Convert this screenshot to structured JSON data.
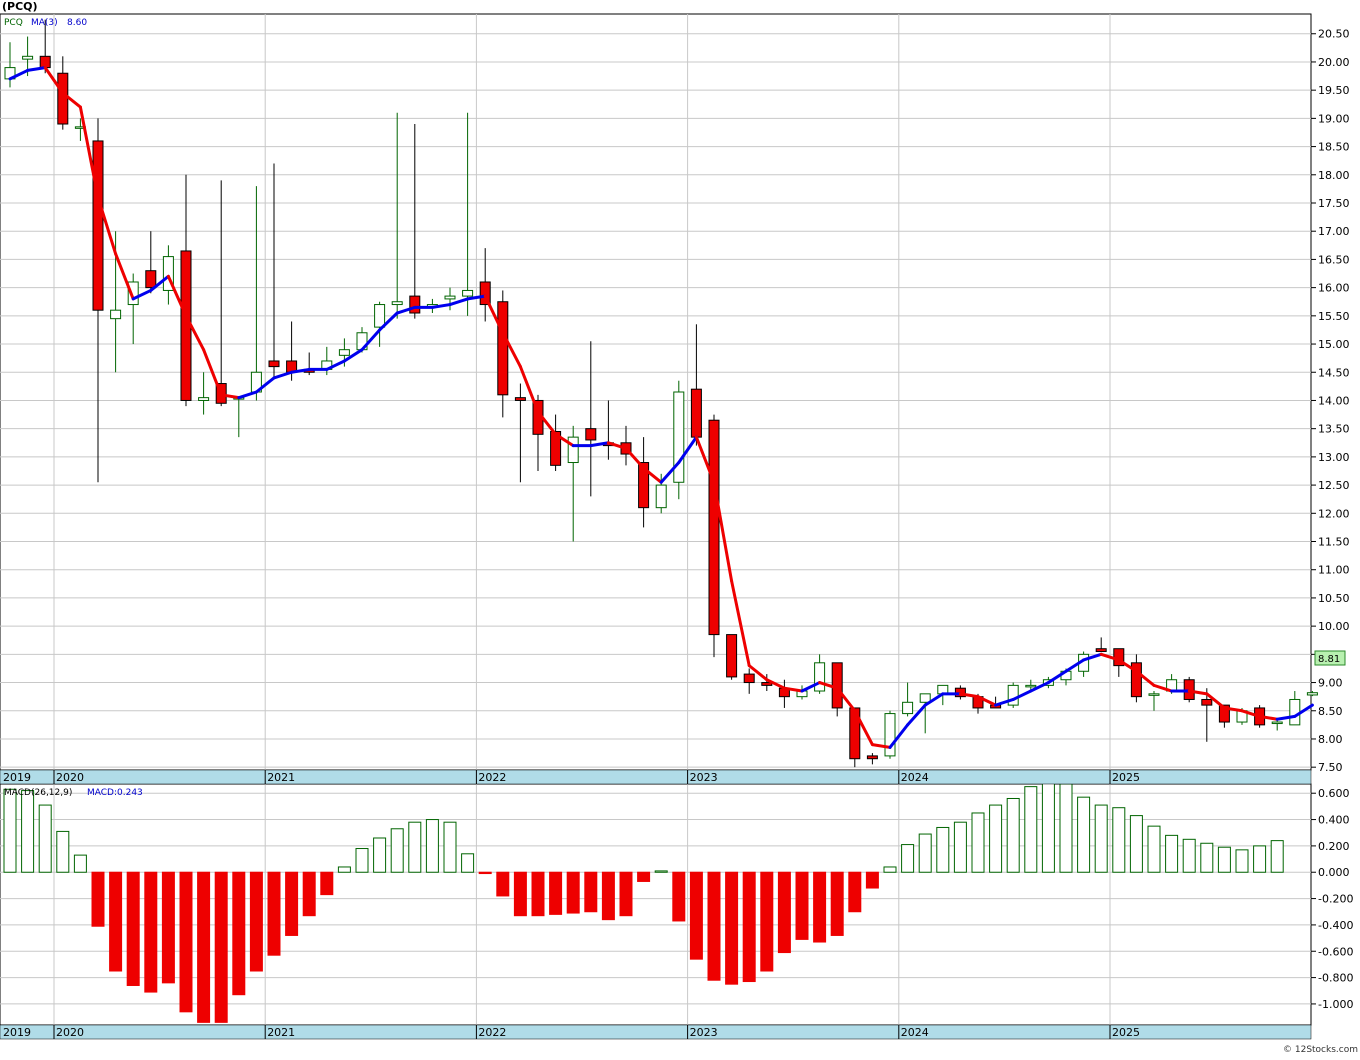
{
  "header": {
    "symbol_title": "(PCQ)",
    "legend_symbol": "PCQ",
    "ma_label": "MA(3)",
    "ma_value": "8.60",
    "last_price_badge": "8.81",
    "macd_label": "MACD(26,12,9)",
    "macd_value": "MACD:0.243",
    "watermark": "© 12Stocks.com"
  },
  "colors": {
    "up_candle_stroke": "#006400",
    "down_candle_fill": "#ee0000",
    "ma_up": "#0000ee",
    "ma_down": "#ee0000",
    "grid": "#c8c8c8",
    "date_band": "#b0dce8",
    "macd_pos_stroke": "#006400",
    "macd_neg_fill": "#ee0000",
    "badge_fill": "#b8f0b0"
  },
  "chart_data": [
    {
      "type": "candlestick",
      "title": "(PCQ)",
      "interval": "monthly",
      "ylim": [
        7.45,
        20.85
      ],
      "y_ticks": [
        "20.50",
        "20.00",
        "19.50",
        "19.00",
        "18.50",
        "18.00",
        "17.50",
        "17.00",
        "16.50",
        "16.00",
        "15.50",
        "15.00",
        "14.50",
        "14.00",
        "13.50",
        "13.00",
        "12.50",
        "12.00",
        "11.50",
        "11.00",
        "10.50",
        "10.00",
        "9.50",
        "9.00",
        "8.50",
        "8.00",
        "7.50"
      ],
      "x_labels": [
        "2019",
        "2020",
        "2021",
        "2022",
        "2023",
        "2024",
        "2025"
      ],
      "grid": true,
      "ohlc": [
        {
          "o": 19.7,
          "h": 20.35,
          "l": 19.55,
          "c": 19.9
        },
        {
          "o": 20.05,
          "h": 20.45,
          "l": 19.75,
          "c": 20.1
        },
        {
          "o": 20.1,
          "h": 20.75,
          "l": 19.8,
          "c": 19.9
        },
        {
          "o": 19.8,
          "h": 20.1,
          "l": 18.8,
          "c": 18.9
        },
        {
          "o": 18.85,
          "h": 19.0,
          "l": 18.6,
          "c": 18.85
        },
        {
          "o": 18.6,
          "h": 19.0,
          "l": 12.55,
          "c": 15.6
        },
        {
          "o": 15.45,
          "h": 17.0,
          "l": 14.5,
          "c": 15.6
        },
        {
          "o": 15.7,
          "h": 16.25,
          "l": 15.0,
          "c": 16.1
        },
        {
          "o": 16.3,
          "h": 17.0,
          "l": 15.9,
          "c": 16.0
        },
        {
          "o": 15.95,
          "h": 16.75,
          "l": 15.7,
          "c": 16.55
        },
        {
          "o": 16.65,
          "h": 18.0,
          "l": 13.9,
          "c": 14.0
        },
        {
          "o": 14.0,
          "h": 14.5,
          "l": 13.75,
          "c": 14.05
        },
        {
          "o": 14.3,
          "h": 17.9,
          "l": 13.9,
          "c": 13.95
        },
        {
          "o": 14.05,
          "h": 14.05,
          "l": 13.35,
          "c": 14.05
        },
        {
          "o": 14.15,
          "h": 17.8,
          "l": 14.0,
          "c": 14.5
        },
        {
          "o": 14.7,
          "h": 18.2,
          "l": 14.4,
          "c": 14.6
        },
        {
          "o": 14.7,
          "h": 15.4,
          "l": 14.35,
          "c": 14.5
        },
        {
          "o": 14.55,
          "h": 14.85,
          "l": 14.45,
          "c": 14.5
        },
        {
          "o": 14.55,
          "h": 14.95,
          "l": 14.45,
          "c": 14.7
        },
        {
          "o": 14.8,
          "h": 15.1,
          "l": 14.6,
          "c": 14.9
        },
        {
          "o": 14.9,
          "h": 15.3,
          "l": 14.85,
          "c": 15.2
        },
        {
          "o": 15.3,
          "h": 15.75,
          "l": 14.95,
          "c": 15.7
        },
        {
          "o": 15.7,
          "h": 19.1,
          "l": 15.45,
          "c": 15.75
        },
        {
          "o": 15.85,
          "h": 18.9,
          "l": 15.45,
          "c": 15.55
        },
        {
          "o": 15.65,
          "h": 15.8,
          "l": 15.55,
          "c": 15.7
        },
        {
          "o": 15.8,
          "h": 16.0,
          "l": 15.6,
          "c": 15.85
        },
        {
          "o": 15.85,
          "h": 19.1,
          "l": 15.5,
          "c": 15.95
        },
        {
          "o": 16.1,
          "h": 16.7,
          "l": 15.4,
          "c": 15.7
        },
        {
          "o": 15.75,
          "h": 15.95,
          "l": 13.7,
          "c": 14.1
        },
        {
          "o": 14.05,
          "h": 14.3,
          "l": 12.55,
          "c": 14.0
        },
        {
          "o": 14.0,
          "h": 14.1,
          "l": 12.75,
          "c": 13.4
        },
        {
          "o": 13.45,
          "h": 13.75,
          "l": 12.75,
          "c": 12.85
        },
        {
          "o": 12.9,
          "h": 13.55,
          "l": 11.5,
          "c": 13.35
        },
        {
          "o": 13.5,
          "h": 15.05,
          "l": 12.3,
          "c": 13.3
        },
        {
          "o": 13.25,
          "h": 14.0,
          "l": 12.95,
          "c": 13.2
        },
        {
          "o": 13.25,
          "h": 13.55,
          "l": 12.85,
          "c": 13.05
        },
        {
          "o": 12.9,
          "h": 13.35,
          "l": 11.75,
          "c": 12.1
        },
        {
          "o": 12.1,
          "h": 12.7,
          "l": 12.0,
          "c": 12.5
        },
        {
          "o": 12.55,
          "h": 14.35,
          "l": 12.25,
          "c": 14.15
        },
        {
          "o": 14.2,
          "h": 15.35,
          "l": 13.2,
          "c": 13.35
        },
        {
          "o": 13.65,
          "h": 13.75,
          "l": 9.45,
          "c": 9.85
        },
        {
          "o": 9.85,
          "h": 9.85,
          "l": 9.05,
          "c": 9.1
        },
        {
          "o": 9.15,
          "h": 9.25,
          "l": 8.8,
          "c": 9.0
        },
        {
          "o": 9.0,
          "h": 9.15,
          "l": 8.85,
          "c": 8.95
        },
        {
          "o": 8.9,
          "h": 9.05,
          "l": 8.55,
          "c": 8.75
        },
        {
          "o": 8.75,
          "h": 8.95,
          "l": 8.7,
          "c": 8.85
        },
        {
          "o": 8.85,
          "h": 9.5,
          "l": 8.8,
          "c": 9.35
        },
        {
          "o": 9.35,
          "h": 9.35,
          "l": 8.4,
          "c": 8.55
        },
        {
          "o": 8.55,
          "h": 8.55,
          "l": 7.5,
          "c": 7.65
        },
        {
          "o": 7.7,
          "h": 7.75,
          "l": 7.55,
          "c": 7.65
        },
        {
          "o": 7.7,
          "h": 8.5,
          "l": 7.65,
          "c": 8.45
        },
        {
          "o": 8.45,
          "h": 9.0,
          "l": 8.4,
          "c": 8.65
        },
        {
          "o": 8.65,
          "h": 8.8,
          "l": 8.1,
          "c": 8.8
        },
        {
          "o": 8.8,
          "h": 8.95,
          "l": 8.6,
          "c": 8.95
        },
        {
          "o": 8.9,
          "h": 8.95,
          "l": 8.7,
          "c": 8.75
        },
        {
          "o": 8.75,
          "h": 8.8,
          "l": 8.45,
          "c": 8.55
        },
        {
          "o": 8.6,
          "h": 8.75,
          "l": 8.55,
          "c": 8.55
        },
        {
          "o": 8.6,
          "h": 9.0,
          "l": 8.55,
          "c": 8.95
        },
        {
          "o": 8.95,
          "h": 9.05,
          "l": 8.85,
          "c": 8.95
        },
        {
          "o": 8.95,
          "h": 9.1,
          "l": 8.9,
          "c": 9.05
        },
        {
          "o": 9.05,
          "h": 9.25,
          "l": 8.95,
          "c": 9.2
        },
        {
          "o": 9.2,
          "h": 9.55,
          "l": 9.1,
          "c": 9.5
        },
        {
          "o": 9.6,
          "h": 9.8,
          "l": 9.55,
          "c": 9.55
        },
        {
          "o": 9.6,
          "h": 9.6,
          "l": 9.1,
          "c": 9.3
        },
        {
          "o": 9.35,
          "h": 9.5,
          "l": 8.65,
          "c": 8.75
        },
        {
          "o": 8.8,
          "h": 8.85,
          "l": 8.5,
          "c": 8.8
        },
        {
          "o": 8.85,
          "h": 9.15,
          "l": 8.8,
          "c": 9.05
        },
        {
          "o": 9.05,
          "h": 9.1,
          "l": 8.65,
          "c": 8.7
        },
        {
          "o": 8.7,
          "h": 8.9,
          "l": 7.95,
          "c": 8.6
        },
        {
          "o": 8.6,
          "h": 8.6,
          "l": 8.2,
          "c": 8.3
        },
        {
          "o": 8.3,
          "h": 8.55,
          "l": 8.25,
          "c": 8.5
        },
        {
          "o": 8.55,
          "h": 8.6,
          "l": 8.2,
          "c": 8.25
        },
        {
          "o": 8.3,
          "h": 8.35,
          "l": 8.15,
          "c": 8.3
        },
        {
          "o": 8.25,
          "h": 8.85,
          "l": 8.25,
          "c": 8.7
        },
        {
          "o": 8.78,
          "h": 8.85,
          "l": 8.76,
          "c": 8.82
        }
      ],
      "ma3": [
        19.7,
        19.85,
        19.9,
        19.45,
        19.2,
        17.6,
        16.6,
        15.8,
        15.95,
        16.2,
        15.5,
        14.9,
        14.1,
        14.05,
        14.15,
        14.4,
        14.5,
        14.55,
        14.55,
        14.7,
        14.9,
        15.25,
        15.55,
        15.65,
        15.65,
        15.7,
        15.8,
        15.85,
        15.2,
        14.6,
        13.8,
        13.4,
        13.2,
        13.2,
        13.25,
        13.15,
        12.8,
        12.55,
        12.9,
        13.35,
        12.55,
        10.8,
        9.3,
        9.05,
        8.9,
        8.85,
        9.0,
        8.9,
        8.5,
        7.9,
        7.85,
        8.25,
        8.6,
        8.8,
        8.8,
        8.75,
        8.6,
        8.7,
        8.85,
        9.0,
        9.2,
        9.4,
        9.5,
        9.4,
        9.2,
        8.95,
        8.85,
        8.85,
        8.8,
        8.55,
        8.5,
        8.4,
        8.35,
        8.4,
        8.6
      ]
    },
    {
      "type": "bar",
      "title": "MACD(26,12,9)",
      "ylim": [
        -1.16,
        0.67
      ],
      "y_ticks": [
        "0.600",
        "0.400",
        "0.200",
        "0.000",
        "-0.200",
        "-0.400",
        "-0.600",
        "-0.800",
        "-1.000"
      ],
      "x_labels": [
        "2019",
        "2020",
        "2021",
        "2022",
        "2023",
        "2024",
        "2025"
      ],
      "values": [
        0.63,
        0.62,
        0.51,
        0.31,
        0.13,
        -0.41,
        -0.75,
        -0.86,
        -0.91,
        -0.84,
        -1.06,
        -1.14,
        -1.14,
        -0.93,
        -0.75,
        -0.63,
        -0.48,
        -0.33,
        -0.17,
        0.04,
        0.18,
        0.26,
        0.33,
        0.38,
        0.4,
        0.38,
        0.14,
        -0.01,
        -0.18,
        -0.33,
        -0.33,
        -0.32,
        -0.31,
        -0.3,
        -0.36,
        -0.33,
        -0.07,
        0.01,
        -0.37,
        -0.66,
        -0.82,
        -0.85,
        -0.83,
        -0.75,
        -0.61,
        -0.51,
        -0.53,
        -0.48,
        -0.3,
        -0.12,
        0.04,
        0.21,
        0.29,
        0.34,
        0.38,
        0.45,
        0.51,
        0.56,
        0.65,
        0.68,
        0.67,
        0.57,
        0.51,
        0.49,
        0.43,
        0.35,
        0.28,
        0.25,
        0.22,
        0.19,
        0.17,
        0.2,
        0.24
      ]
    }
  ]
}
